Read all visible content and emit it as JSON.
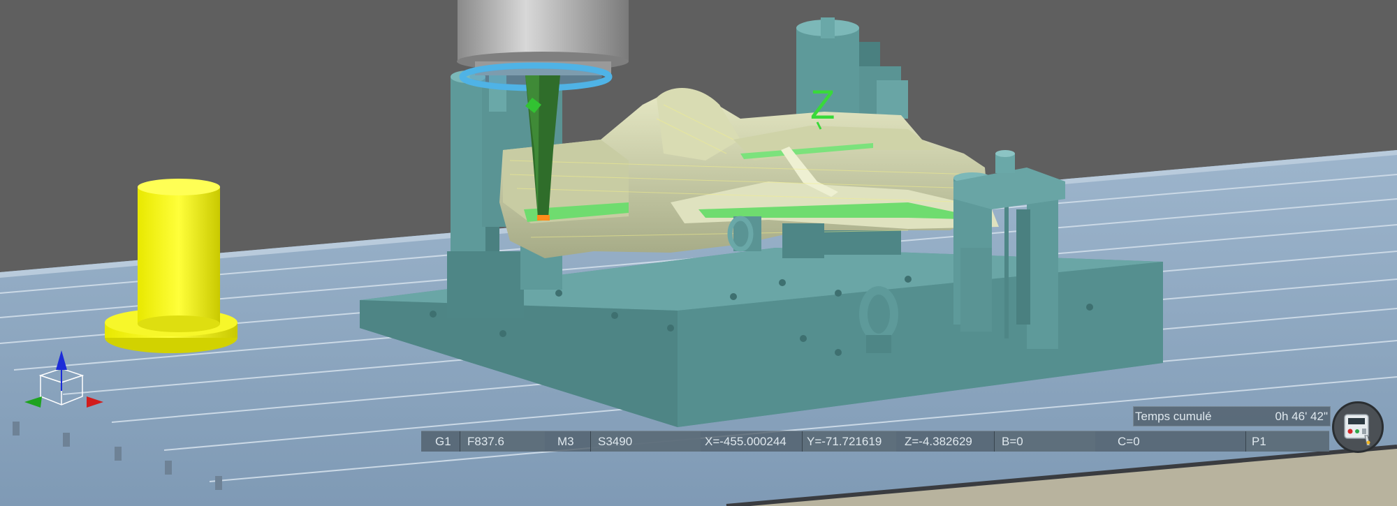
{
  "viewport": {
    "axis_letter": "Z"
  },
  "status_bar": {
    "g_code": "G1",
    "feed": "F837.6",
    "m_code": "M3",
    "spindle": "S3490",
    "x": "X=-455.000244",
    "y": "Y=-71.721619",
    "z": "Z=-4.382629",
    "b": "B=0",
    "c": "C=0",
    "program": "P1"
  },
  "timer": {
    "label": "Temps cumulé",
    "value": "0h 46' 42\""
  },
  "icons": {
    "triad": "axis-triad-icon",
    "remote": "pendant-remote-icon"
  },
  "colors": {
    "background": "#5f5f5f",
    "table": "#8fa9c2",
    "fixture": "#5f9a9a",
    "part": "#cfd8a6",
    "toolpath": "#5bd65b",
    "cylinder": "#f2f200",
    "tool": "#2e6e2a"
  }
}
